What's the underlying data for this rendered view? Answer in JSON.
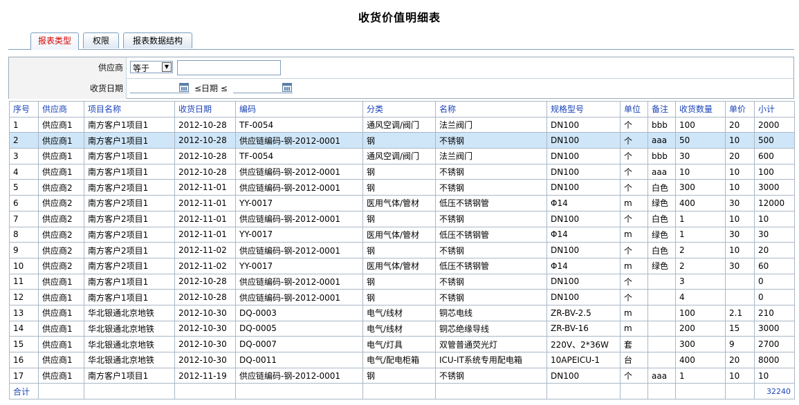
{
  "page_title": "收货价值明细表",
  "tabs": [
    {
      "label": "报表类型",
      "active": true
    },
    {
      "label": "权限",
      "active": false
    },
    {
      "label": "报表数据结构",
      "active": false
    }
  ],
  "filter": {
    "supplier_label": "供应商",
    "supplier_operator": "等于",
    "supplier_value": "",
    "date_label": "收货日期",
    "date_range_text": "≤日期 ≤",
    "date_from": "",
    "date_to": ""
  },
  "table": {
    "headers": [
      "序号",
      "供应商",
      "项目名称",
      "收货日期",
      "编码",
      "分类",
      "名称",
      "规格型号",
      "单位",
      "备注",
      "收货数量",
      "单价",
      "小计"
    ],
    "rows": [
      [
        "1",
        "供应商1",
        "南方客户1项目1",
        "2012-10-28",
        "TF-0054",
        "通风空调/阀门",
        "法兰阀门",
        "DN100",
        "个",
        "bbb",
        "100",
        "20",
        "2000"
      ],
      [
        "2",
        "供应商1",
        "南方客户1项目1",
        "2012-10-28",
        "供应链编码-钢-2012-0001",
        "钢",
        "不锈钢",
        "DN100",
        "个",
        "aaa",
        "50",
        "10",
        "500"
      ],
      [
        "3",
        "供应商1",
        "南方客户1项目1",
        "2012-10-28",
        "TF-0054",
        "通风空调/阀门",
        "法兰阀门",
        "DN100",
        "个",
        "bbb",
        "30",
        "20",
        "600"
      ],
      [
        "4",
        "供应商1",
        "南方客户1项目1",
        "2012-10-28",
        "供应链编码-钢-2012-0001",
        "钢",
        "不锈钢",
        "DN100",
        "个",
        "aaa",
        "10",
        "10",
        "100"
      ],
      [
        "5",
        "供应商2",
        "南方客户2项目1",
        "2012-11-01",
        "供应链编码-钢-2012-0001",
        "钢",
        "不锈钢",
        "DN100",
        "个",
        "白色",
        "300",
        "10",
        "3000"
      ],
      [
        "6",
        "供应商2",
        "南方客户2项目1",
        "2012-11-01",
        "YY-0017",
        "医用气体/管材",
        "低压不锈钢管",
        "Φ14",
        "m",
        "绿色",
        "400",
        "30",
        "12000"
      ],
      [
        "7",
        "供应商2",
        "南方客户2项目1",
        "2012-11-01",
        "供应链编码-钢-2012-0001",
        "钢",
        "不锈钢",
        "DN100",
        "个",
        "白色",
        "1",
        "10",
        "10"
      ],
      [
        "8",
        "供应商2",
        "南方客户2项目1",
        "2012-11-01",
        "YY-0017",
        "医用气体/管材",
        "低压不锈钢管",
        "Φ14",
        "m",
        "绿色",
        "1",
        "30",
        "30"
      ],
      [
        "9",
        "供应商2",
        "南方客户2项目1",
        "2012-11-02",
        "供应链编码-钢-2012-0001",
        "钢",
        "不锈钢",
        "DN100",
        "个",
        "白色",
        "2",
        "10",
        "20"
      ],
      [
        "10",
        "供应商2",
        "南方客户2项目1",
        "2012-11-02",
        "YY-0017",
        "医用气体/管材",
        "低压不锈钢管",
        "Φ14",
        "m",
        "绿色",
        "2",
        "30",
        "60"
      ],
      [
        "11",
        "供应商1",
        "南方客户1项目1",
        "2012-10-28",
        "供应链编码-钢-2012-0001",
        "钢",
        "不锈钢",
        "DN100",
        "个",
        "",
        "3",
        "",
        "0"
      ],
      [
        "12",
        "供应商1",
        "南方客户1项目1",
        "2012-10-28",
        "供应链编码-钢-2012-0001",
        "钢",
        "不锈钢",
        "DN100",
        "个",
        "",
        "4",
        "",
        "0"
      ],
      [
        "13",
        "供应商1",
        "华北银通北京地铁",
        "2012-10-30",
        "DQ-0003",
        "电气/线材",
        "铜芯电线",
        "ZR-BV-2.5",
        "m",
        "",
        "100",
        "2.1",
        "210"
      ],
      [
        "14",
        "供应商1",
        "华北银通北京地铁",
        "2012-10-30",
        "DQ-0005",
        "电气/线材",
        "铜芯绝缘导线",
        "ZR-BV-16",
        "m",
        "",
        "200",
        "15",
        "3000"
      ],
      [
        "15",
        "供应商1",
        "华北银通北京地铁",
        "2012-10-30",
        "DQ-0007",
        "电气/灯具",
        "双管普通荧光灯",
        "220V、2*36W",
        "套",
        "",
        "300",
        "9",
        "2700"
      ],
      [
        "16",
        "供应商1",
        "华北银通北京地铁",
        "2012-10-30",
        "DQ-0011",
        "电气/配电柜箱",
        "ICU-IT系统专用配电箱",
        "10APEICU-1",
        "台",
        "",
        "400",
        "20",
        "8000"
      ],
      [
        "17",
        "供应商1",
        "南方客户1项目1",
        "2012-11-19",
        "供应链编码-钢-2012-0001",
        "钢",
        "不锈钢",
        "DN100",
        "个",
        "aaa",
        "1",
        "10",
        "10"
      ]
    ],
    "selected_row": 1,
    "total_label": "合计",
    "total_value": "32240"
  },
  "colors": {
    "header_text": "#1a44b8",
    "active_tab_text": "#d40000",
    "selected_row_bg": "#cfe6f8",
    "grid_border": "#a9b7c6"
  }
}
